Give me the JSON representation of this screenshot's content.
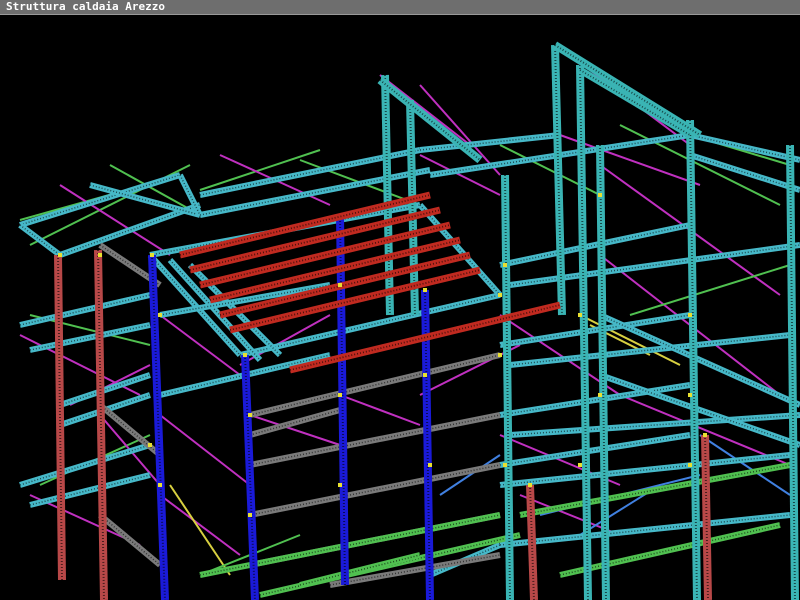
{
  "window": {
    "title": "Struttura caldaia Arezzo"
  },
  "colors": {
    "background": "#000000",
    "titlebar": "#6e6e6e",
    "column_blue": "#1a1ad8",
    "column_red": "#b84848",
    "column_cyan": "#3ab4b4",
    "beam_red": "#c02a20",
    "beam_cyan": "#46b8c8",
    "beam_grey": "#7a7a7a",
    "brace_magenta": "#c030c0",
    "brace_green": "#50c050",
    "brace_yellow": "#d8d040",
    "brace_lightblue": "#4080e0",
    "node_yellow": "#e8e030"
  },
  "viewport": {
    "content": "3d-steel-structure-wireframe"
  }
}
